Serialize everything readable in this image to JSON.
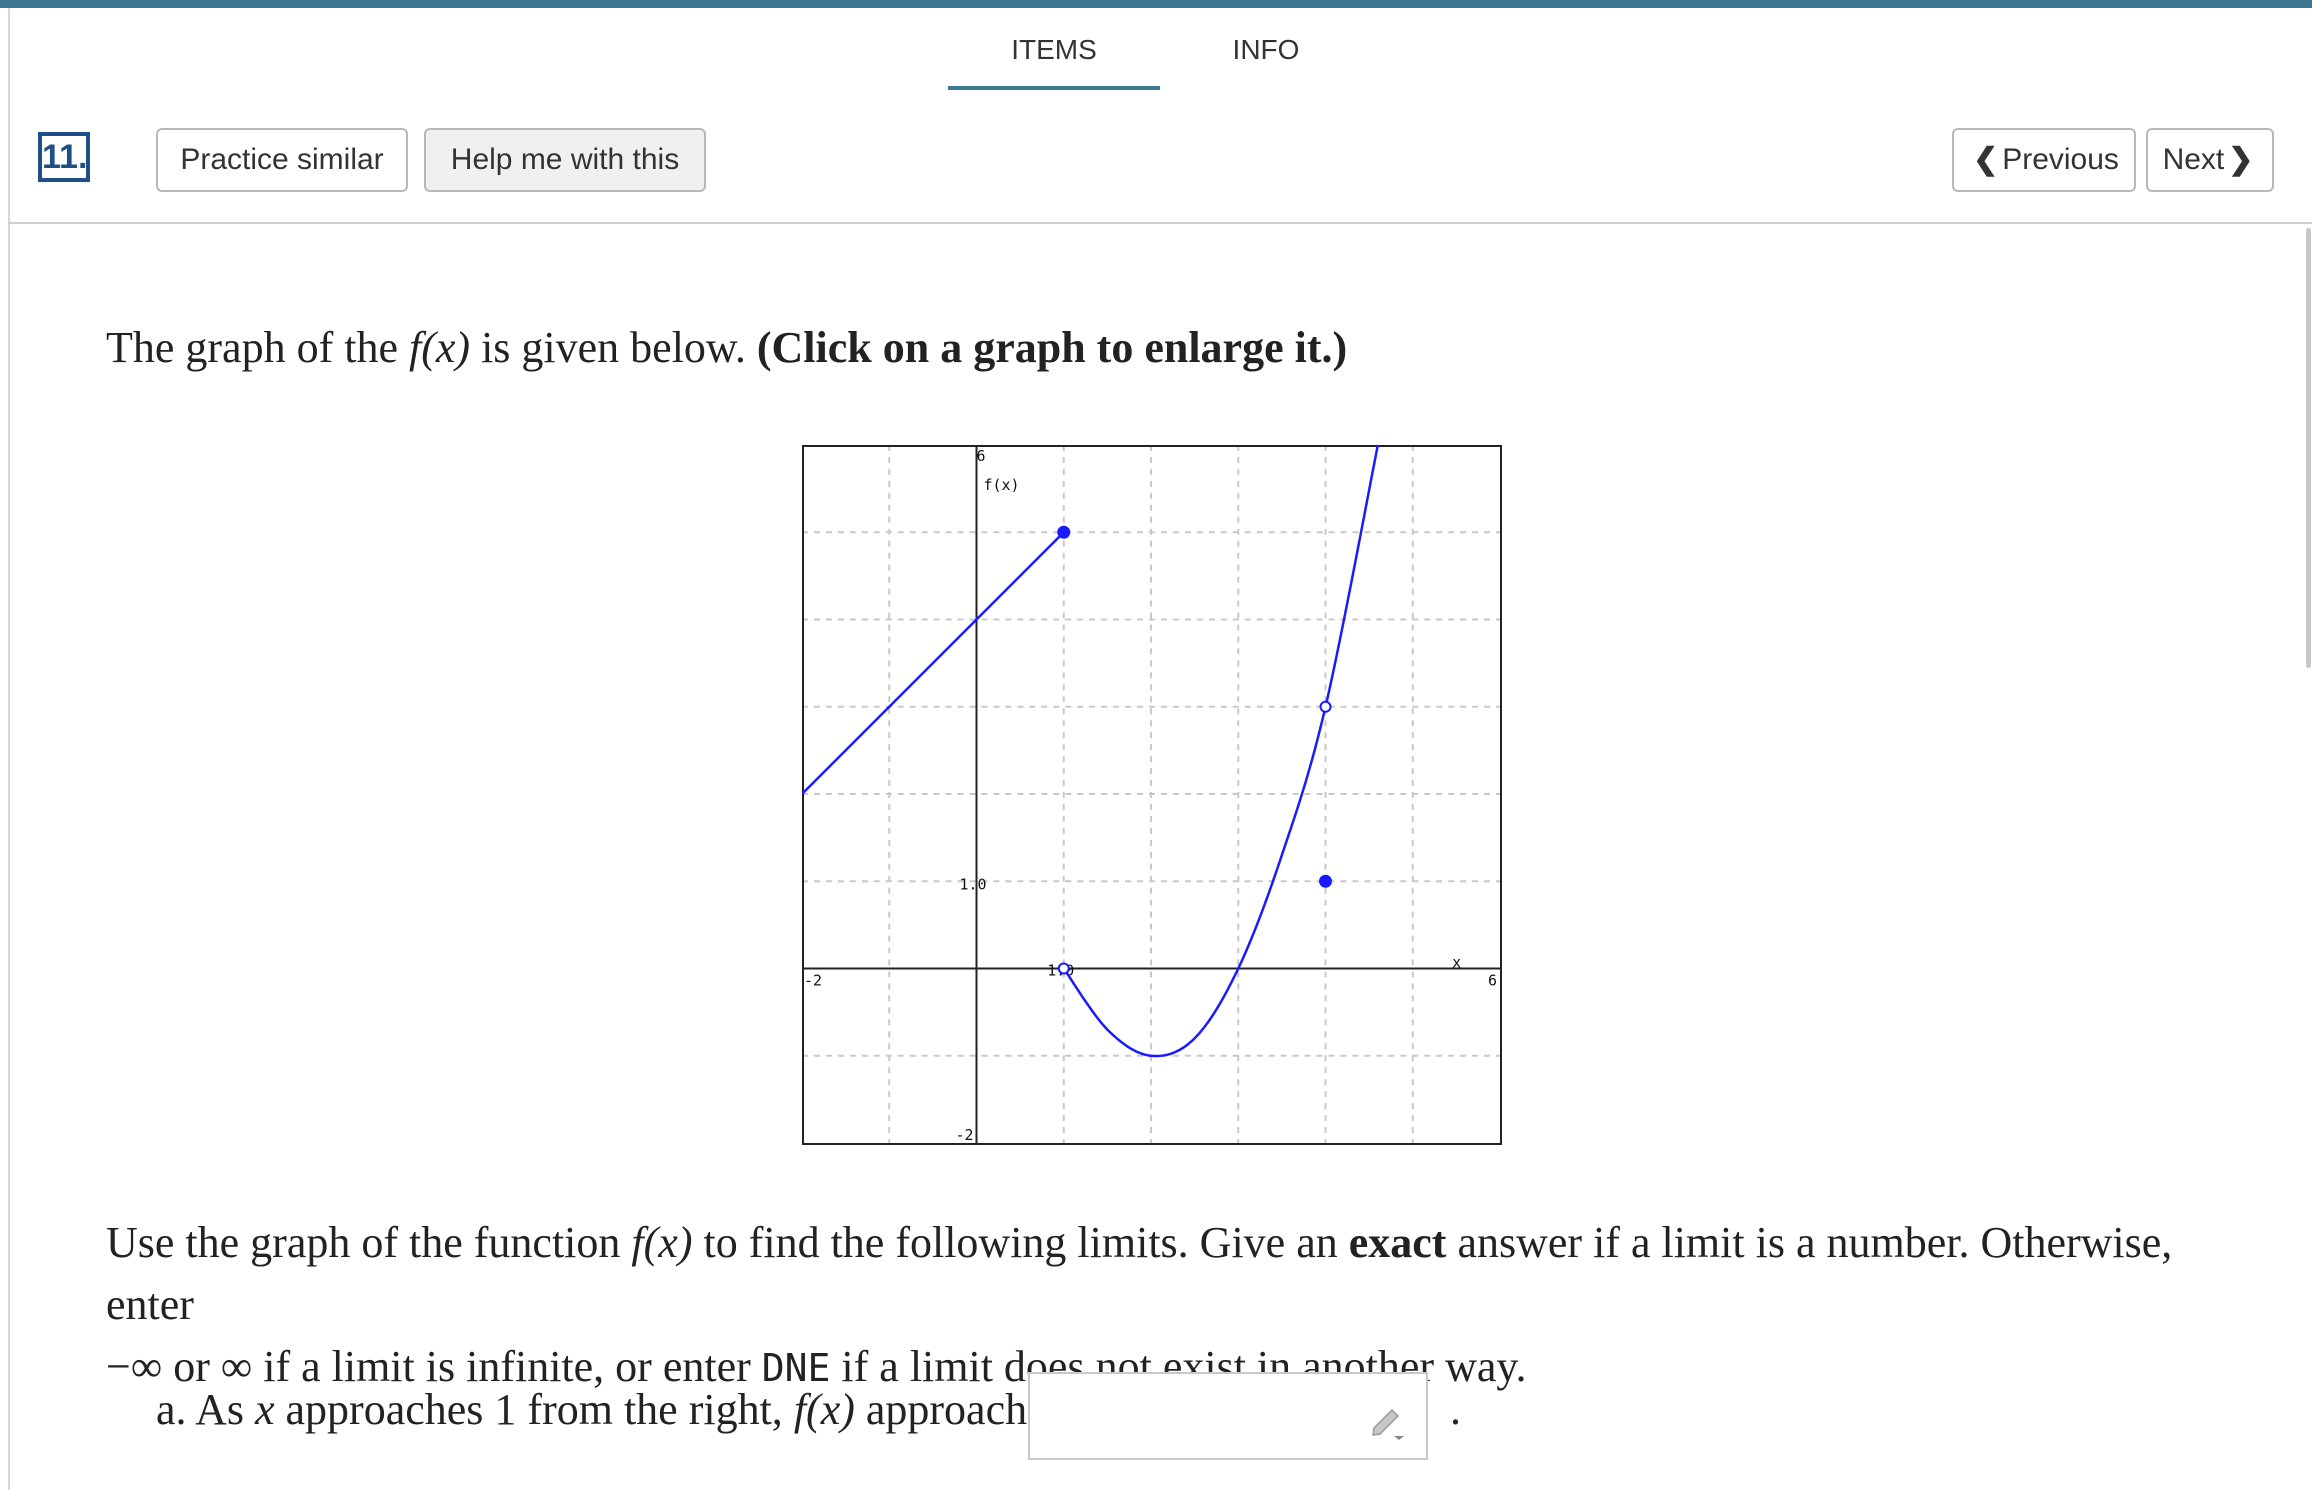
{
  "tabs": [
    {
      "label": "ITEMS",
      "active": true
    },
    {
      "label": "INFO",
      "active": false
    }
  ],
  "question_number": "11.",
  "buttons": {
    "practice_similar": "Practice similar",
    "help_me": "Help me with this",
    "previous": "Previous",
    "next": "Next"
  },
  "intro": {
    "text_before": "The graph of the ",
    "function": "f(x)",
    "text_after": " is given below. ",
    "bold": "(Click on a graph to enlarge it.)"
  },
  "graph": {
    "y_label": "f(x)",
    "x_label": "x",
    "ticks": {
      "x_min": "-2",
      "x_max": "6",
      "y_max": "6",
      "y_min": "-2",
      "y_one": "1.0",
      "x_one": "1.0"
    },
    "line_color": "#1a1aff"
  },
  "chart_data": {
    "type": "line",
    "xlim": [
      -2,
      6
    ],
    "ylim": [
      -2,
      6
    ],
    "grid": true,
    "series": [
      {
        "x": [
          -2,
          1
        ],
        "y": [
          2,
          5
        ],
        "end_markers": {
          "right": "closed"
        }
      },
      {
        "x": [
          1,
          1.5,
          2,
          2.5,
          3,
          3.5,
          4,
          4.6
        ],
        "y": [
          0,
          -0.7,
          -1,
          -0.8,
          0,
          1.3,
          3,
          6
        ],
        "end_markers": {
          "left": "open"
        }
      }
    ],
    "points": [
      {
        "x": 4,
        "y": 3,
        "marker": "open"
      },
      {
        "x": 4,
        "y": 1,
        "marker": "closed"
      }
    ]
  },
  "paragraph": {
    "part1": "Use the graph of the function ",
    "function": "f(x)",
    "part2": " to find the following limits. Give an ",
    "bold": "exact",
    "part3": " answer if a limit is a number. Otherwise, enter",
    "neg_inf": "−∞",
    "or": " or ",
    "inf": "∞",
    "part4": " if a limit is infinite, or enter ",
    "dne": "DNE",
    "part5": " if a limit does not exist in another way."
  },
  "question_a": {
    "prefix": "a. As ",
    "var": "x",
    "middle": " approaches 1 from the right, ",
    "function": "f(x)",
    "suffix": " approaches",
    "period": ".",
    "answer_value": ""
  }
}
